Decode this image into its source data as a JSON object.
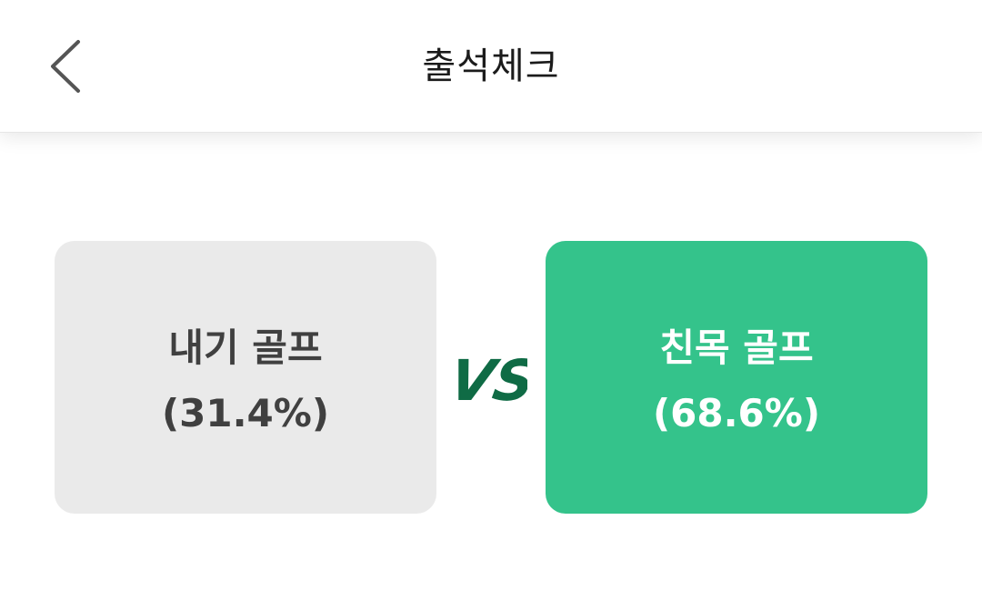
{
  "header": {
    "title": "출석체크",
    "back_icon": "chevron-left-icon"
  },
  "vote": {
    "left_option": {
      "label": "내기 골프",
      "percent": "(31.4%)",
      "value": 31.4,
      "background_color": "#eaeaea",
      "text_color": "#404040"
    },
    "vs_label": "VS",
    "vs_color": "#0f6b45",
    "right_option": {
      "label": "친목 골프",
      "percent": "(68.6%)",
      "value": 68.6,
      "background_color": "#34c38b",
      "text_color": "#ffffff"
    }
  }
}
